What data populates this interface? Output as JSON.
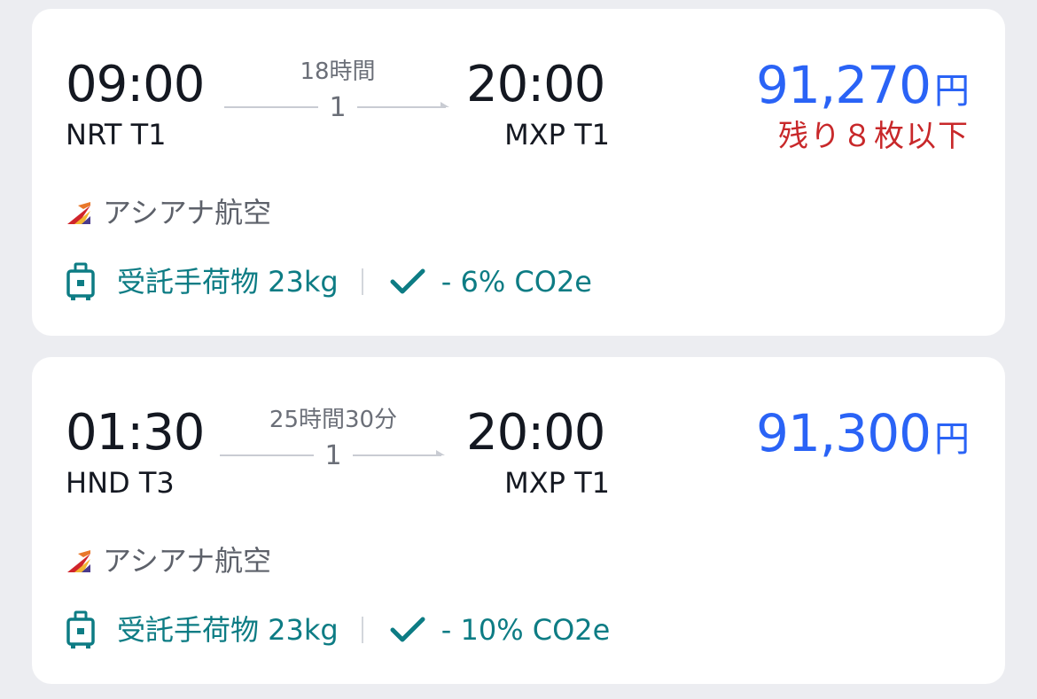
{
  "flights": [
    {
      "departure_time": "09:00",
      "departure_airport": "NRT T1",
      "duration": "18時間",
      "stops": "1",
      "arrival_time": "20:00",
      "arrival_airport": "MXP T1",
      "price": "91,270",
      "currency": "円",
      "seats_left": "残り８枚以下",
      "airline": "アシアナ航空",
      "baggage": "受託手荷物 23kg",
      "co2": "- 6% CO2e"
    },
    {
      "departure_time": "01:30",
      "departure_airport": "HND T3",
      "duration": "25時間30分",
      "stops": "1",
      "arrival_time": "20:00",
      "arrival_airport": "MXP T1",
      "price": "91,300",
      "currency": "円",
      "seats_left": "",
      "airline": "アシアナ航空",
      "baggage": "受託手荷物 23kg",
      "co2": "- 10% CO2e"
    }
  ],
  "icons": {
    "airline_logo": "asiana-airlines-logo",
    "baggage": "luggage-icon",
    "co2": "checkmark-icon"
  },
  "colors": {
    "background": "#ECEDF1",
    "card": "#FFFFFF",
    "price": "#2A63F6",
    "seats_left": "#C8282A",
    "feature": "#0D7C84",
    "airline_name": "#5D616A"
  }
}
